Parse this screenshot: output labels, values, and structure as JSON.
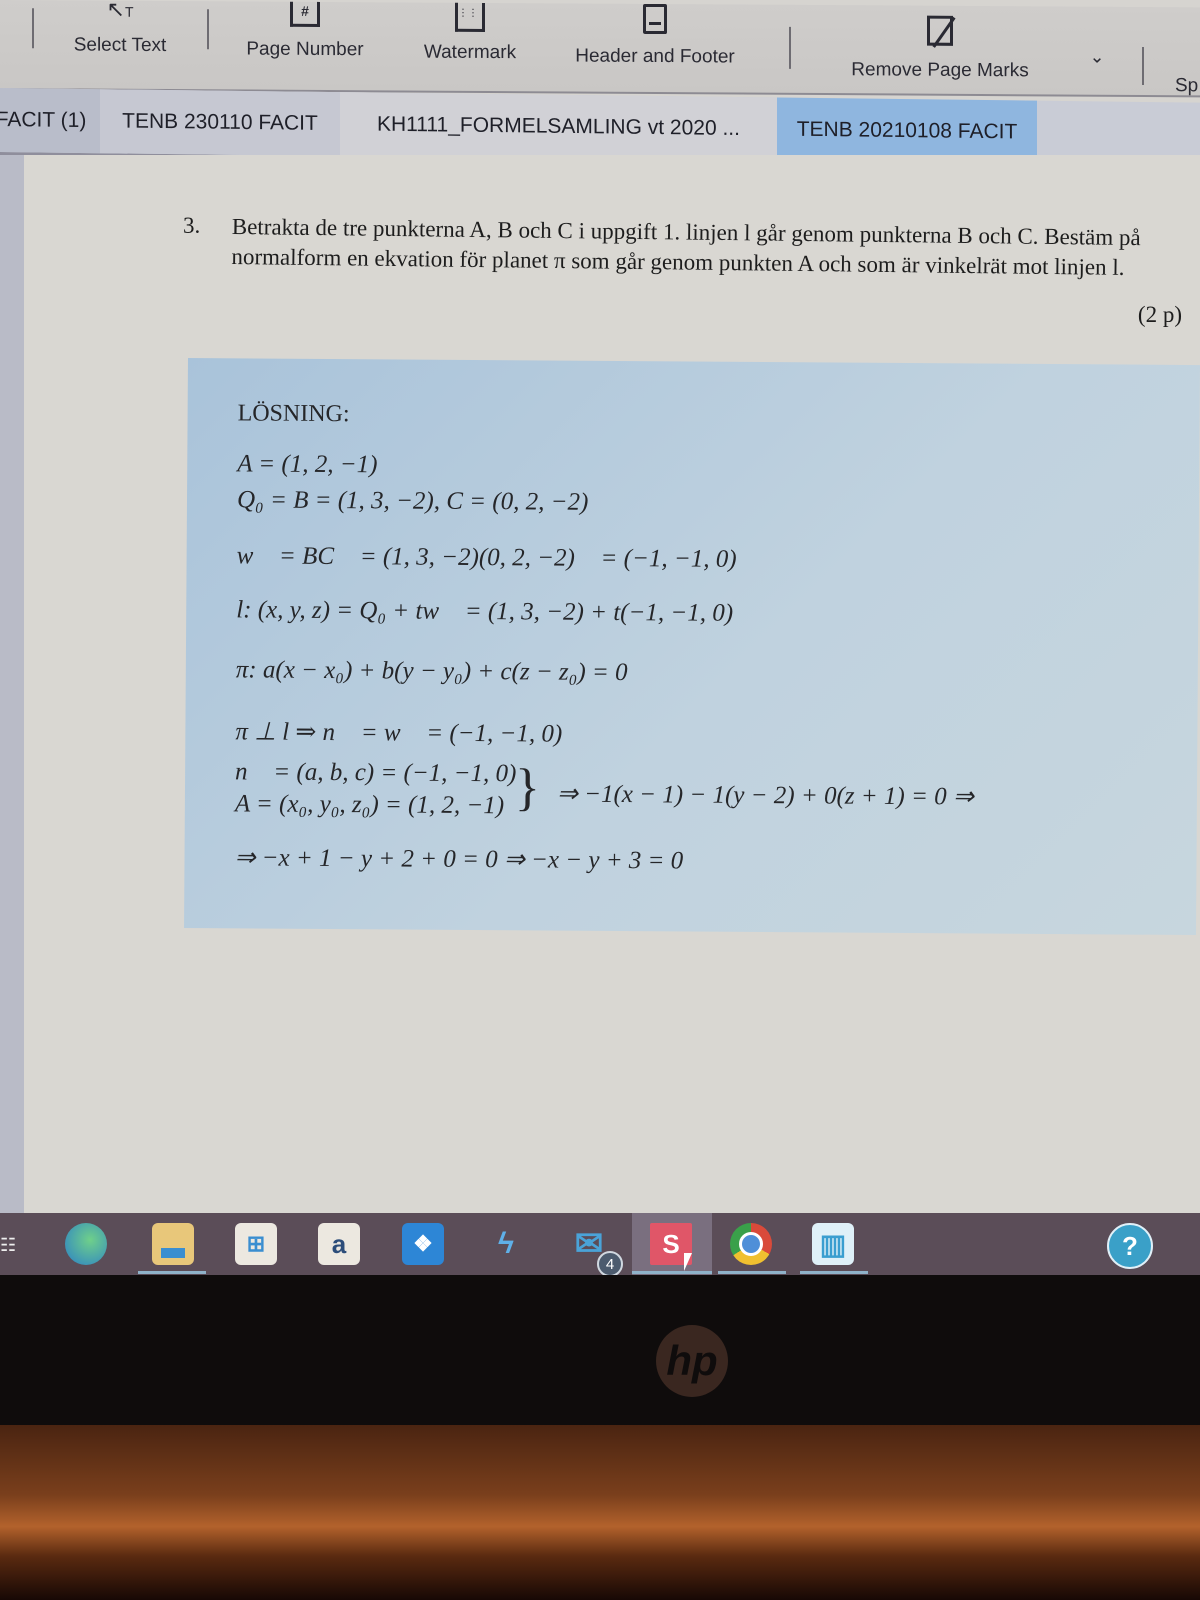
{
  "toolbar": {
    "items": [
      {
        "label": "Select Text",
        "icon": "select-text-icon"
      },
      {
        "label": "Page Number",
        "icon": "page-number-icon"
      },
      {
        "label": "Watermark",
        "icon": "watermark-icon"
      },
      {
        "label": "Header and Footer",
        "icon": "header-footer-icon"
      },
      {
        "label": "Remove Page Marks",
        "icon": "remove-page-marks-icon"
      },
      {
        "label": "Sp",
        "icon": ""
      }
    ],
    "dropdown": "chevron-down-icon"
  },
  "tabs": [
    {
      "label": "FACIT (1)",
      "active": false
    },
    {
      "label": "TENB 230110 FACIT",
      "active": false
    },
    {
      "label": "KH1111_FORMELSAMLING vt 2020 ...",
      "active": false
    },
    {
      "label": "TENB 20210108 FACIT",
      "active": true
    }
  ],
  "document": {
    "question_number": "3.",
    "question_text": "Betrakta de tre punkterna A, B och C i uppgift 1. linjen l går genom punkterna B och C. Bestäm på normalform en ekvation för planet π som går genom punkten A och som är vinkelrät mot linjen l.",
    "points": "(2 p)",
    "solution": {
      "title": "LÖSNING:",
      "lines": [
        "A = (1, 2, −1)",
        "Q₀ = B = (1, 3, −2), C = (0, 2, −2)",
        "w⃗ = BC⃗ = (1, 3, −2)(0, 2, −2)⃗ = (−1, −1, 0)",
        "l: (x, y, z) = Q₀ + tw⃗ = (1, 3, −2) + t(−1, −1, 0)",
        "π: a(x − x₀) + b(y − y₀) + c(z − z₀) = 0",
        "π ⊥ l ⇒ n⃗ = w⃗ = (−1, −1, 0)",
        "n⃗ = (a, b, c) = (−1, −1, 0)",
        "A = (x₀, y₀, z₀) = (1, 2, −1)",
        "⇒ −1(x − 1) − 1(y − 2) + 0(z + 1) = 0 ⇒",
        "⇒ −x + 1 − y + 2 + 0 = 0 ⇒ −x − y + 3 = 0"
      ]
    }
  },
  "taskbar": {
    "apps": [
      {
        "name": "edge-icon",
        "glyph": "e",
        "color": "#3b9bd4"
      },
      {
        "name": "file-explorer-icon",
        "glyph": "",
        "color": "#e8c77a"
      },
      {
        "name": "microsoft-store-icon",
        "glyph": "⊞",
        "color": "#e8e4dc"
      },
      {
        "name": "amazon-icon",
        "glyph": "a",
        "color": "#ece8e0"
      },
      {
        "name": "dropbox-icon",
        "glyph": "❖",
        "color": "#2d86d6"
      },
      {
        "name": "app-bolt-icon",
        "glyph": "⚡",
        "color": "transparent"
      },
      {
        "name": "mail-icon",
        "glyph": "✉",
        "color": "#4aa3d8",
        "badge": "4"
      },
      {
        "name": "s-app-icon",
        "glyph": "S",
        "color": "#e05668"
      },
      {
        "name": "chrome-icon",
        "glyph": "◉",
        "color": "#e0b030"
      },
      {
        "name": "city-app-icon",
        "glyph": "▥",
        "color": "#5aaed8"
      },
      {
        "name": "help-icon",
        "glyph": "?",
        "color": "#3aa0c8"
      }
    ]
  },
  "device": {
    "logo": "hp"
  }
}
